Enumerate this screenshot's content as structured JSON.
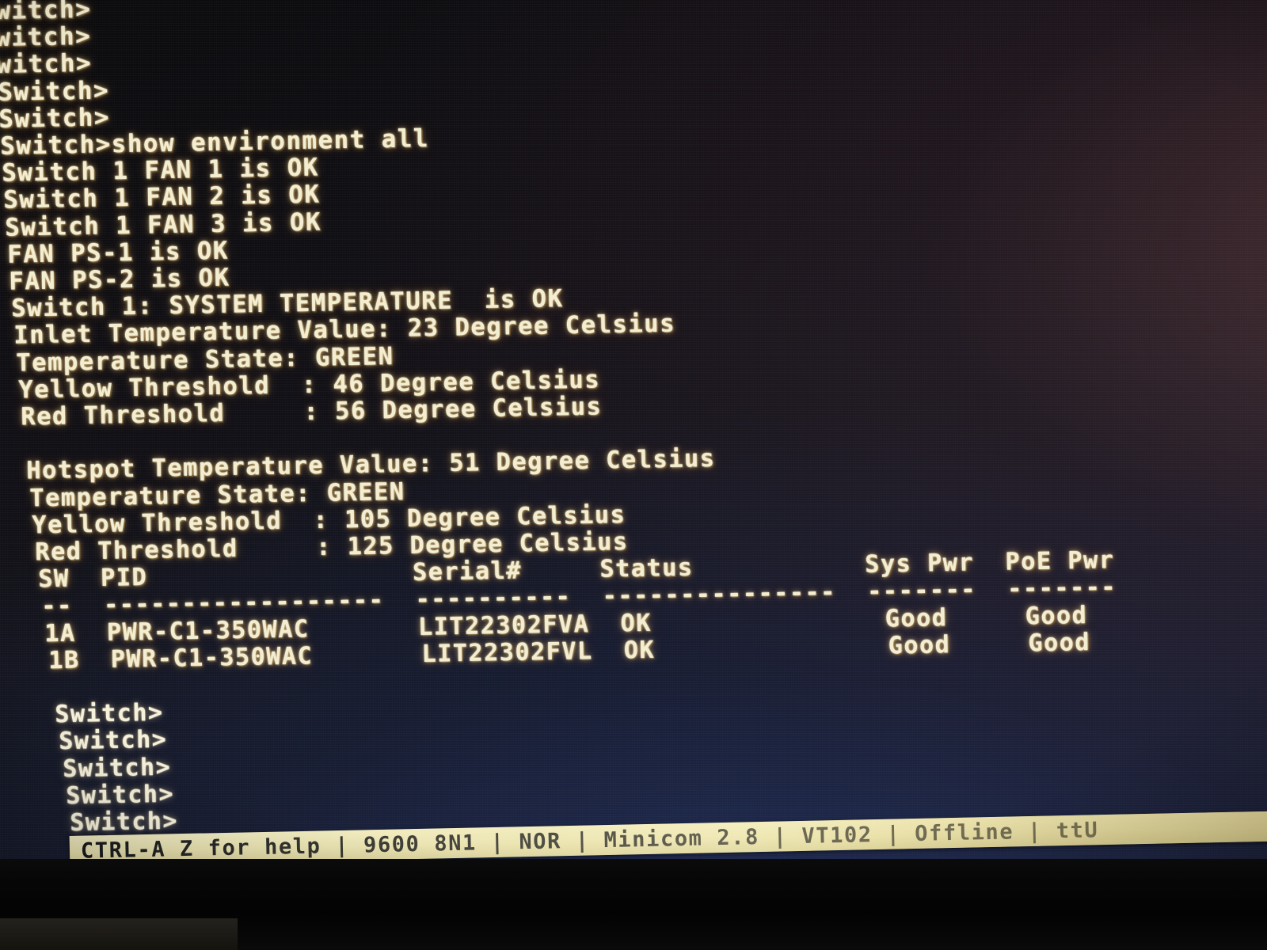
{
  "terminal": {
    "app": "Minicom 2.8",
    "emulation": "VT102",
    "state": "Offline",
    "baud": "9600 8N1",
    "flow": "NOR",
    "device": "tt",
    "prompt": "Switch>",
    "command": "show environment all",
    "lines": [
      "witch>",
      "witch>",
      "witch>",
      "Switch>",
      "Switch>",
      "Switch>show environment all",
      "Switch 1 FAN 1 is OK",
      "Switch 1 FAN 2 is OK",
      "Switch 1 FAN 3 is OK",
      "FAN PS-1 is OK",
      "FAN PS-2 is OK",
      "Switch 1: SYSTEM TEMPERATURE  is OK",
      "Inlet Temperature Value: 23 Degree Celsius",
      "Temperature State: GREEN",
      "Yellow Threshold  : 46 Degree Celsius",
      "Red Threshold     : 56 Degree Celsius",
      "",
      "Hotspot Temperature Value: 51 Degree Celsius",
      "Temperature State: GREEN",
      "Yellow Threshold  : 105 Degree Celsius",
      "Red Threshold     : 125 Degree Celsius",
      "SW  PID                 Serial#     Status           Sys Pwr  PoE Pwr",
      "--  ------------------  ----------  ---------------  -------  -------",
      "1A  PWR-C1-350WAC       LIT22302FVA  OK               Good     Good",
      "1B  PWR-C1-350WAC       LIT22302FVL  OK               Good     Good",
      "",
      "Switch>",
      "Switch>",
      "Switch>",
      "Switch>",
      "Switch>",
      "Switch>",
      "Switch>"
    ]
  },
  "environment": {
    "fans": [
      {
        "label": "Switch 1 FAN 1",
        "status": "OK"
      },
      {
        "label": "Switch 1 FAN 2",
        "status": "OK"
      },
      {
        "label": "Switch 1 FAN 3",
        "status": "OK"
      },
      {
        "label": "FAN PS-1",
        "status": "OK"
      },
      {
        "label": "FAN PS-2",
        "status": "OK"
      }
    ],
    "system_temperature_status": "Switch 1: SYSTEM TEMPERATURE  is OK",
    "sensors": [
      {
        "name": "Inlet Temperature",
        "value": "23",
        "unit": "Degree Celsius",
        "state": "GREEN",
        "yellow_threshold": "46",
        "red_threshold": "56"
      },
      {
        "name": "Hotspot Temperature",
        "value": "51",
        "unit": "Degree Celsius",
        "state": "GREEN",
        "yellow_threshold": "105",
        "red_threshold": "125"
      }
    ],
    "power_table": {
      "headers": [
        "SW",
        "PID",
        "Serial#",
        "Status",
        "Sys Pwr",
        "PoE Pwr"
      ],
      "rows": [
        [
          "1A",
          "PWR-C1-350WAC",
          "LIT22302FVA",
          "OK",
          "Good",
          "Good"
        ],
        [
          "1B",
          "PWR-C1-350WAC",
          "LIT22302FVL",
          "OK",
          "Good",
          "Good"
        ]
      ]
    }
  },
  "statusbar": {
    "text": "CTRL-A Z for help | 9600 8N1 | NOR | Minicom 2.8 | VT102 | Offline | ttU"
  },
  "colors": {
    "phosphor_text": "#f3eed2",
    "screen_dark": "#0b0b0d",
    "screen_navy": "#191c2c",
    "screen_warm_glow": "#804a4a",
    "statusbar_bg": "#e6dfae",
    "statusbar_text": "#15161a"
  }
}
